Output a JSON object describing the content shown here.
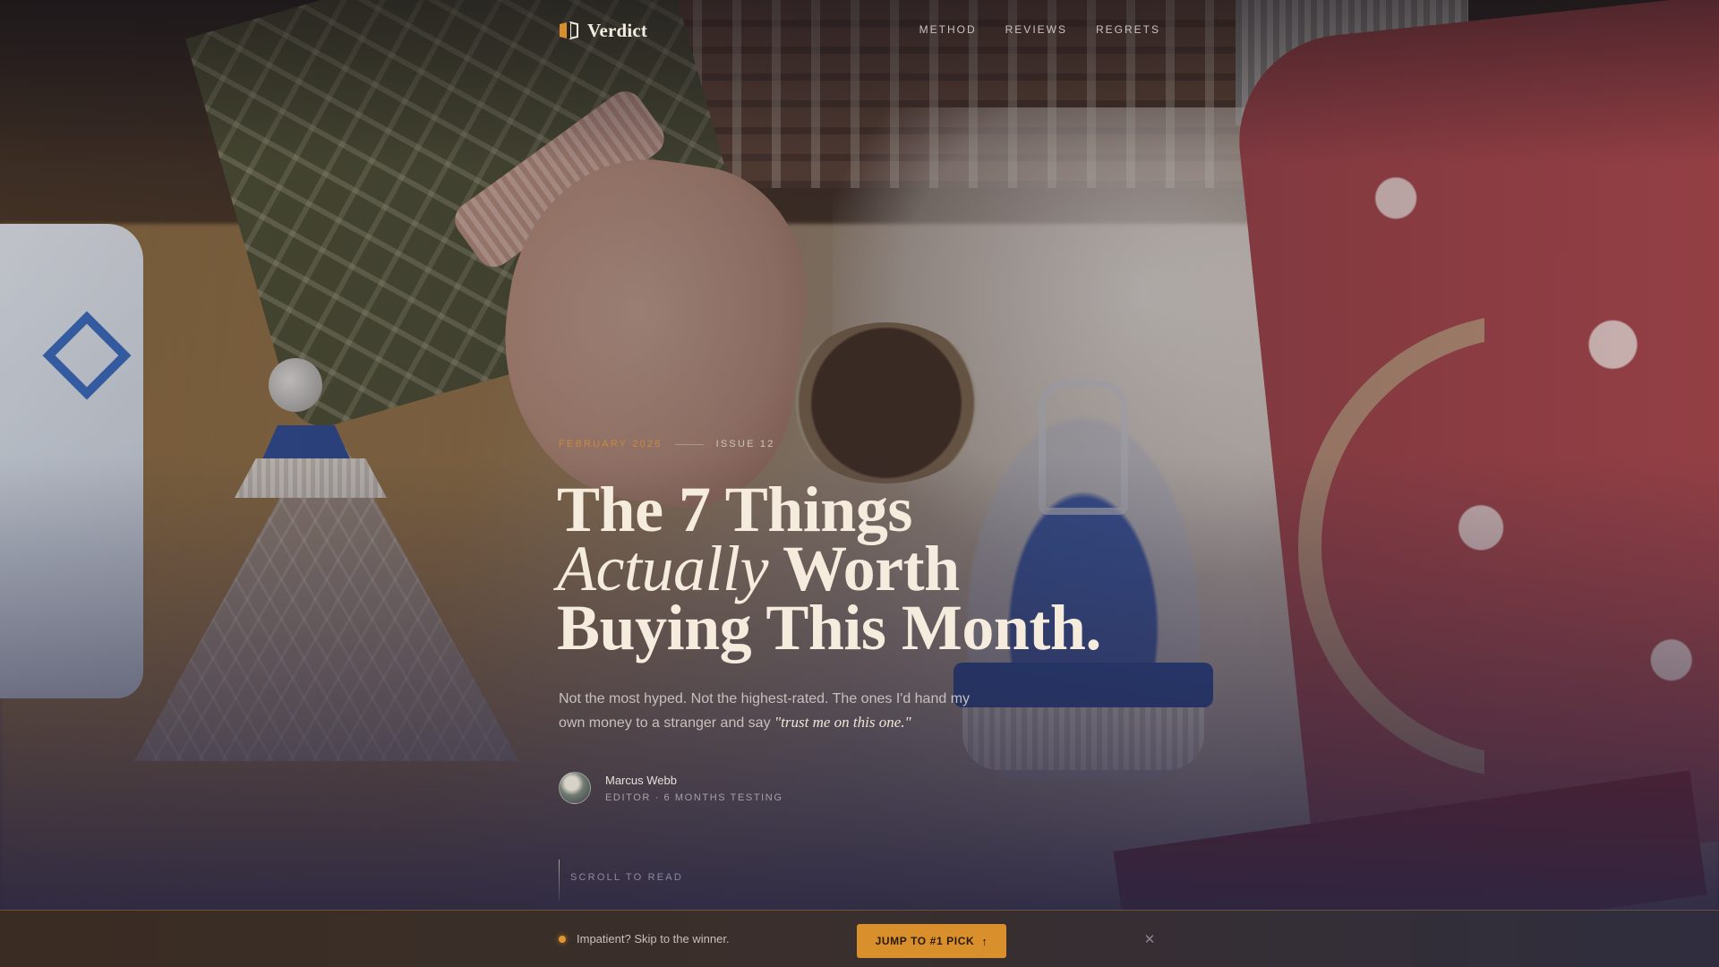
{
  "nav": {
    "brand": "Verdict",
    "links": [
      "METHOD",
      "REVIEWS",
      "REGRETS"
    ]
  },
  "hero": {
    "date": "FEBRUARY 2026",
    "issue": "ISSUE 12",
    "headline_line1": "The 7 Things",
    "headline_italic": "Actually",
    "headline_line2_rest": "Worth",
    "headline_line3": "Buying This Month.",
    "dek": "Not the most hyped. Not the highest-rated. The ones I'd hand my own money to a stranger and say",
    "dek_quote": "\"trust me on this one.\"",
    "author": "Marcus Webb",
    "author_role": "EDITOR · 6 MONTHS TESTING",
    "scroll_label": "SCROLL TO READ"
  },
  "sticky_bar": {
    "text": "Impatient? Skip to the winner.",
    "button_label": "JUMP TO #1 PICK",
    "button_icon": "arrow-up-icon",
    "close_icon": "close-icon"
  },
  "colors": {
    "accent": "#d88f2c",
    "date": "#c88a3a",
    "headline": "#f5ecde"
  }
}
